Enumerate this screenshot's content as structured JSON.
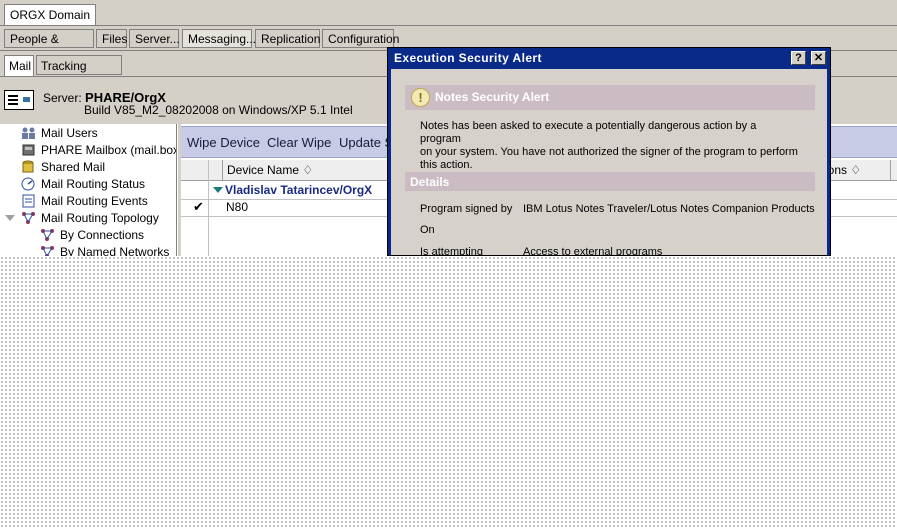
{
  "domain_tab": "ORGX Domain",
  "nav_tabs": [
    "People & Groups",
    "Files",
    "Server...",
    "Messaging...",
    "Replication",
    "Configuration"
  ],
  "sub_tabs": [
    "Mail",
    "Tracking Center"
  ],
  "server": {
    "label": "Server:",
    "name": "PHARE/OrgX",
    "build": "Build V85_M2_08202008 on Windows/XP 5.1 Intel"
  },
  "tree": [
    {
      "label": "Mail Users",
      "icon": "users-icon"
    },
    {
      "label": "PHARE Mailbox (mail.box)",
      "icon": "mailbox-icon"
    },
    {
      "label": "Shared Mail",
      "icon": "shared-mail-icon"
    },
    {
      "label": "Mail Routing Status",
      "icon": "routing-status-icon"
    },
    {
      "label": "Mail Routing Events",
      "icon": "routing-events-icon"
    },
    {
      "label": "Mail Routing Topology",
      "icon": "topology-icon"
    },
    {
      "label": "By Connections",
      "icon": "topology-icon"
    },
    {
      "label": "By Named Networks",
      "icon": "topology-icon"
    }
  ],
  "actions": [
    "Wipe Device",
    "Clear Wipe",
    "Update S"
  ],
  "columns": {
    "device_name": "Device Name ♢",
    "options": "ions ♢"
  },
  "category": "Vladislav Tatarincev/OrgX",
  "row": {
    "check": "✔",
    "value": "N80"
  },
  "dialog": {
    "title": "Execution Security Alert",
    "help_button": "?",
    "close_button": "✕",
    "alert_icon": "!",
    "alert_title": "Notes Security Alert",
    "message_lines": [
      "Notes has been asked to execute a potentially dangerous action by a program",
      "on your system.  You have not authorized the signer of the program to perform",
      "this action."
    ],
    "details_title": "Details",
    "details": [
      {
        "label": "Program signed by",
        "value": "IBM Lotus Notes Traveler/Lotus Notes Companion Products"
      },
      {
        "label": "On",
        "value": ""
      },
      {
        "label": "Is attempting",
        "value": "Access to external programs"
      }
    ]
  },
  "colors": {
    "window_bg": "#d4d0c8",
    "title_blue": "#0a2a8a",
    "action_bar": "#c7cbe6",
    "section_band": "#cbbcc4",
    "category_text": "#1a2a80"
  }
}
